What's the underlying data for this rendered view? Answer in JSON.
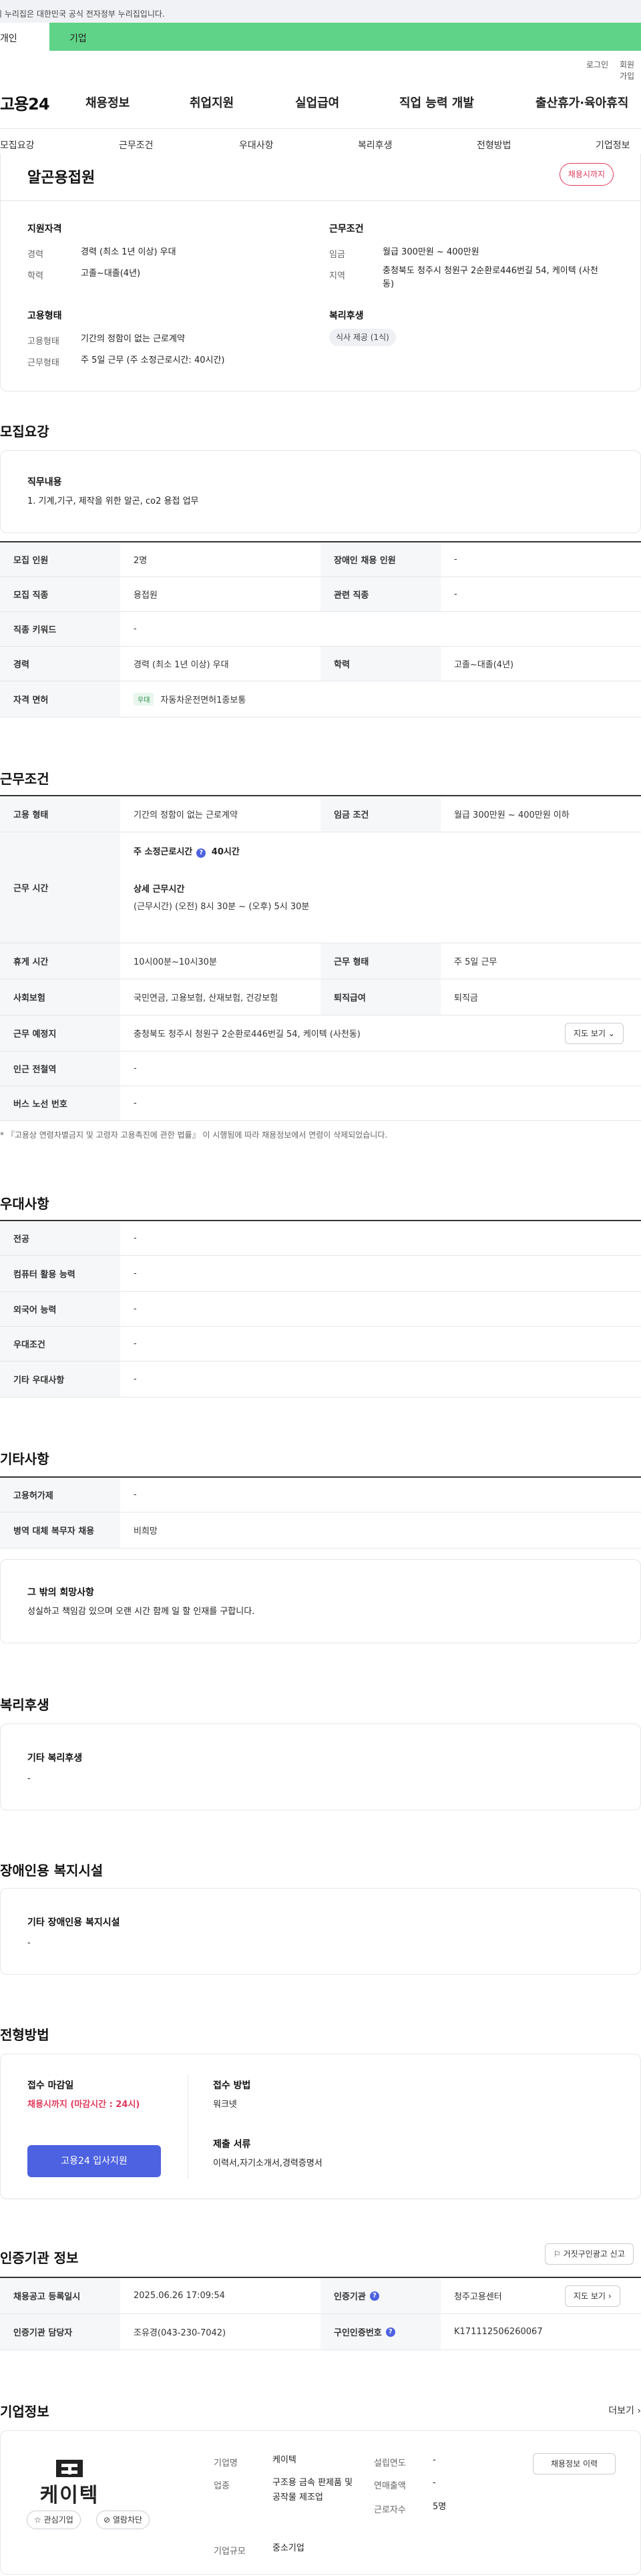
{
  "gov_banner": "이 누리집은 대한민국 공식 전자정부 누리집입니다.",
  "top_tabs": [
    "개인",
    "기업"
  ],
  "util_links": [
    "로그인",
    "회원가입"
  ],
  "site": {
    "logo": "고용24"
  },
  "gnb": [
    "채용정보",
    "취업지원",
    "실업급여",
    "직업 능력 개발",
    "출산휴가·육아휴직"
  ],
  "subnav": [
    "모집요강",
    "근무조건",
    "우대사항",
    "복리후생",
    "전형방법",
    "기업정보"
  ],
  "summary": {
    "title": "알곤용접원",
    "deadline_badge": "채용시까지",
    "apply_heading": "지원자격",
    "career_label": "경력",
    "career_value": "경력 (최소 1년 이상) 우대",
    "edu_label": "학력",
    "edu_value": "고졸~대졸(4년)",
    "work_heading": "근무조건",
    "wage_label": "임금",
    "wage_value": "월급 300만원 ~ 400만원",
    "region_label": "지역",
    "region_value": "충청북도 청주시 청원구 2순환로446번길 54, 케이텍 (사천동)",
    "employ_heading": "고용형태",
    "employ_type_label": "고용형태",
    "employ_type_value": "기간의 정함이 없는 근로계약",
    "hours_label": "근무형태",
    "hours_value": "주 5일 근무 (주 소정근로시간: 40시간)",
    "welfare_heading": "복리후생",
    "welfare_chip": "식사 제공 (1식)"
  },
  "recruit": {
    "title": "모집요강",
    "duty_heading": "직무내용",
    "duty_text": "1. 기계,기구, 제작을 위한 알곤, co2 용접 업무",
    "rows": {
      "count_label": "모집 인원",
      "count_value": "2명",
      "disabled_label": "장애인 채용 인원",
      "disabled_value": "-",
      "job_label": "모집 직종",
      "job_value": "용접원",
      "related_label": "관련 직종",
      "related_value": "-",
      "keyword_label": "직종 키워드",
      "keyword_value": "-",
      "career_label": "경력",
      "career_value": "경력 (최소 1년 이상) 우대",
      "edu_label": "학력",
      "edu_value": "고졸~대졸(4년)",
      "license_label": "자격 면허",
      "license_tag": "우대",
      "license_value": "자동차운전면허1종보통"
    }
  },
  "conditions": {
    "title": "근무조건",
    "employ_label": "고용 형태",
    "employ_value": "기간의 정함이 없는 근로계약",
    "wage_label": "임금 조건",
    "wage_value": "월급 300만원 ~ 400만원 이하",
    "time_label": "근무 시간",
    "time_week": "주 소정근로시간",
    "time_week_value": "40시간",
    "time_detail_heading": "상세 근무시간",
    "time_detail_value": "(근무시간) (오전) 8시 30분 ~ (오후) 5시 30분",
    "break_label": "휴게 시간",
    "break_value": "10시00분~10시30분",
    "form_label": "근무 형태",
    "form_value": "주 5일 근무",
    "insurance_label": "사회보험",
    "insurance_value": "국민연금, 고용보험, 산재보험, 건강보험",
    "retire_label": "퇴직급여",
    "retire_value": "퇴직금",
    "place_label": "근무 예정지",
    "place_value": "충청북도 청주시 청원구 2순환로446번길 54, 케이텍 (사천동)",
    "map_button": "지도 보기",
    "subway_label": "인근 전철역",
    "subway_value": "-",
    "bus_label": "버스 노선 번호",
    "bus_value": "-",
    "note": "* 『고용상 연령차별금지 및 고령자 고용촉진에 관한 법률』 이 시행됨에 따라 채용정보에서 연령이 삭제되었습니다."
  },
  "preferences": {
    "title": "우대사항",
    "rows": [
      {
        "label": "전공",
        "value": "-"
      },
      {
        "label": "컴퓨터 활용 능력",
        "value": "-"
      },
      {
        "label": "외국어 능력",
        "value": "-"
      },
      {
        "label": "우대조건",
        "value": "-"
      },
      {
        "label": "기타 우대사항",
        "value": "-"
      }
    ]
  },
  "other": {
    "title": "기타사항",
    "rows": [
      {
        "label": "고용허가제",
        "value": "-"
      },
      {
        "label": "병역 대체 복무자 채용",
        "value": "비희망"
      }
    ],
    "wish_heading": "그 밖의 희망사항",
    "wish_text": "성실하고 책임감 있으며 오랜 시간 함께 일 할 인재를 구합니다."
  },
  "welfare": {
    "title": "복리후생",
    "box_heading": "기타 복리후생",
    "box_value": "-"
  },
  "disabled_facility": {
    "title": "장애인용 복지시설",
    "box_heading": "기타 장애인용 복지시설",
    "box_value": "-"
  },
  "selection": {
    "title": "전형방법",
    "deadline_heading": "접수 마감일",
    "deadline_value": "채용시까지 (마감시간 : 24시)",
    "method_heading": "접수 방법",
    "method_value": "워크넷",
    "docs_heading": "제출 서류",
    "docs_value": "이력서,자기소개서,경력증명서",
    "apply_button": "고용24 입사지원"
  },
  "auth": {
    "title": "인증기관 정보",
    "report_button": "거짓구인광고 신고",
    "reg_label": "채용공고 등록일시",
    "reg_value": "2025.06.26 17:09:54",
    "agency_label": "인증기관",
    "agency_value": "청주고용센터",
    "map_button": "지도 보기",
    "manager_label": "인증기관 담당자",
    "manager_value": "조유경(043-230-7042)",
    "number_label": "구인인증번호",
    "number_value": "K171112506260067"
  },
  "company": {
    "title": "기업정보",
    "more": "더보기",
    "logo_text": "케이텍",
    "fav_button": "관심기업",
    "block_button": "열람차단",
    "name_label": "기업명",
    "name_value": "케이텍",
    "industry_label": "업종",
    "industry_value": "구조용 금속 판제품 및 공작물 제조업",
    "size_label": "기업규모",
    "size_value": "중소기업",
    "founded_label": "설립연도",
    "founded_value": "-",
    "sales_label": "연매출액",
    "sales_value": "-",
    "emp_label": "근로자수",
    "emp_value": "5명",
    "history_button": "채용정보 이력"
  }
}
